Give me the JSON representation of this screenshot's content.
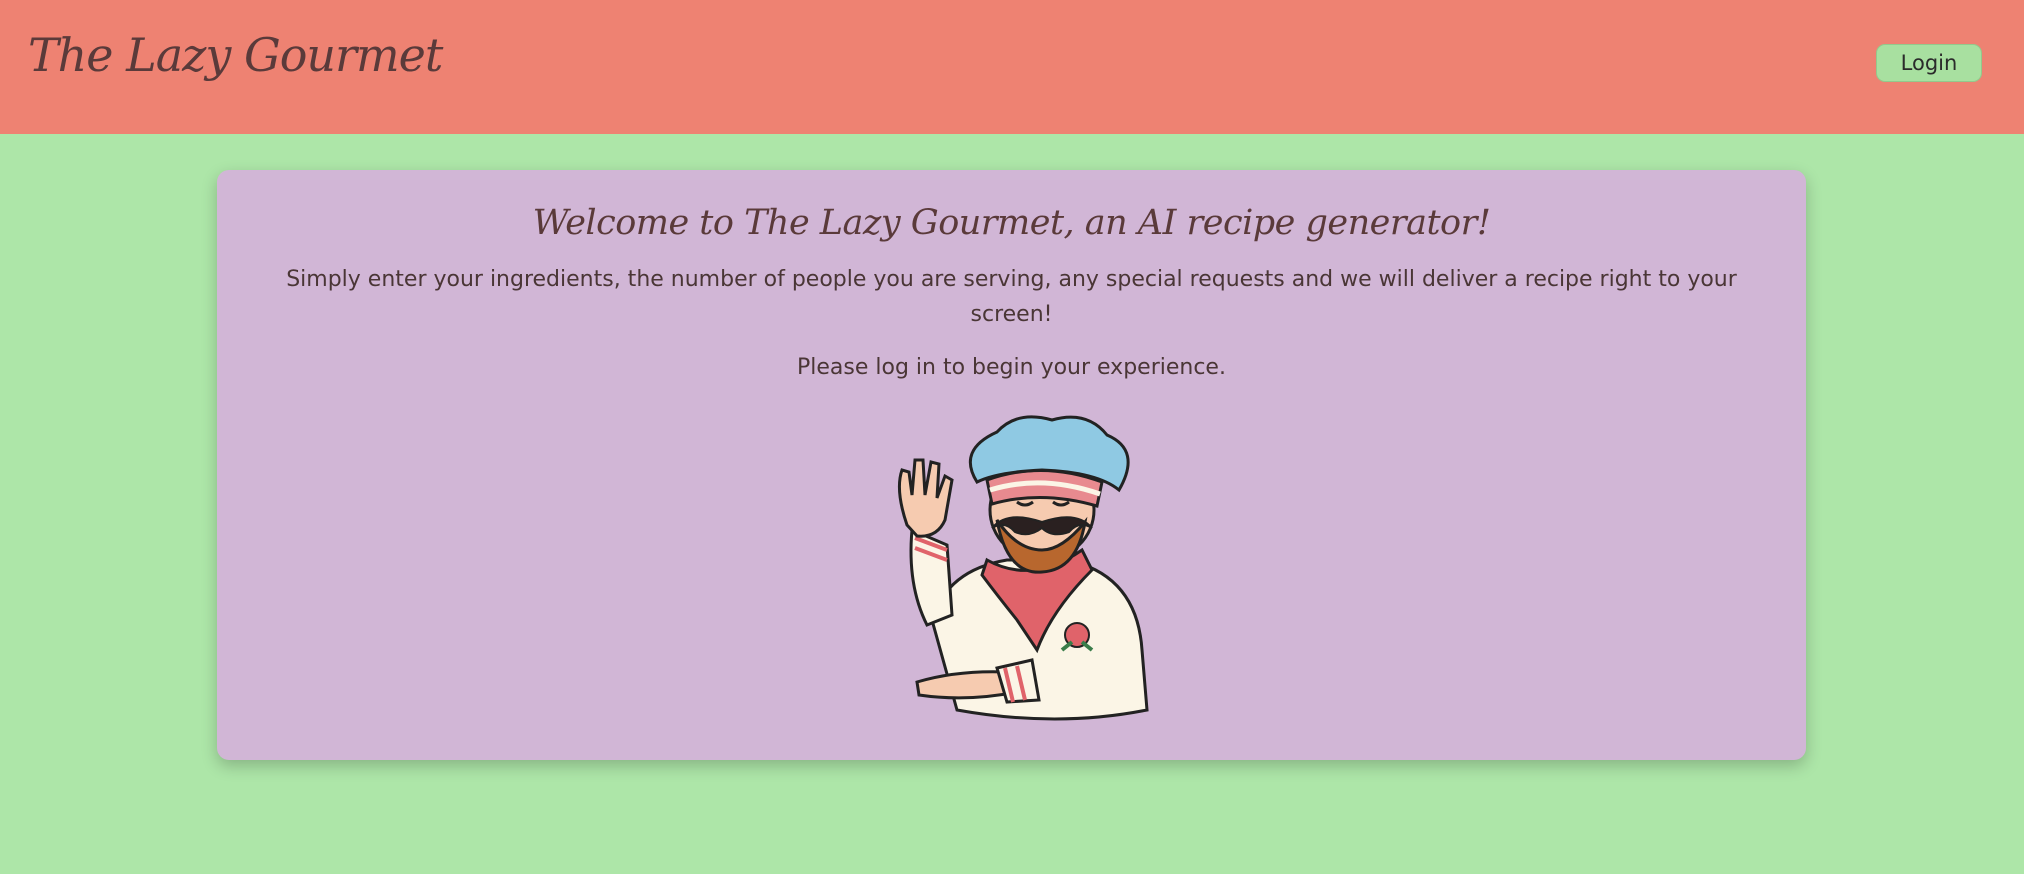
{
  "header": {
    "site_title": "The Lazy Gourmet",
    "login_label": "Login"
  },
  "main": {
    "welcome_title": "Welcome to The Lazy Gourmet, an AI recipe generator!",
    "intro_text": "Simply enter your ingredients, the number of people you are serving, any special requests and we will deliver a recipe right to your screen!",
    "prompt_text": "Please log in to begin your experience.",
    "image_icon": "chef-illustration-icon"
  },
  "colors": {
    "header_bg": "#ee8272",
    "page_bg": "#ade6a8",
    "card_bg": "#d1b6d6",
    "button_bg": "#a8e0a0",
    "text": "#5a3a3a"
  }
}
